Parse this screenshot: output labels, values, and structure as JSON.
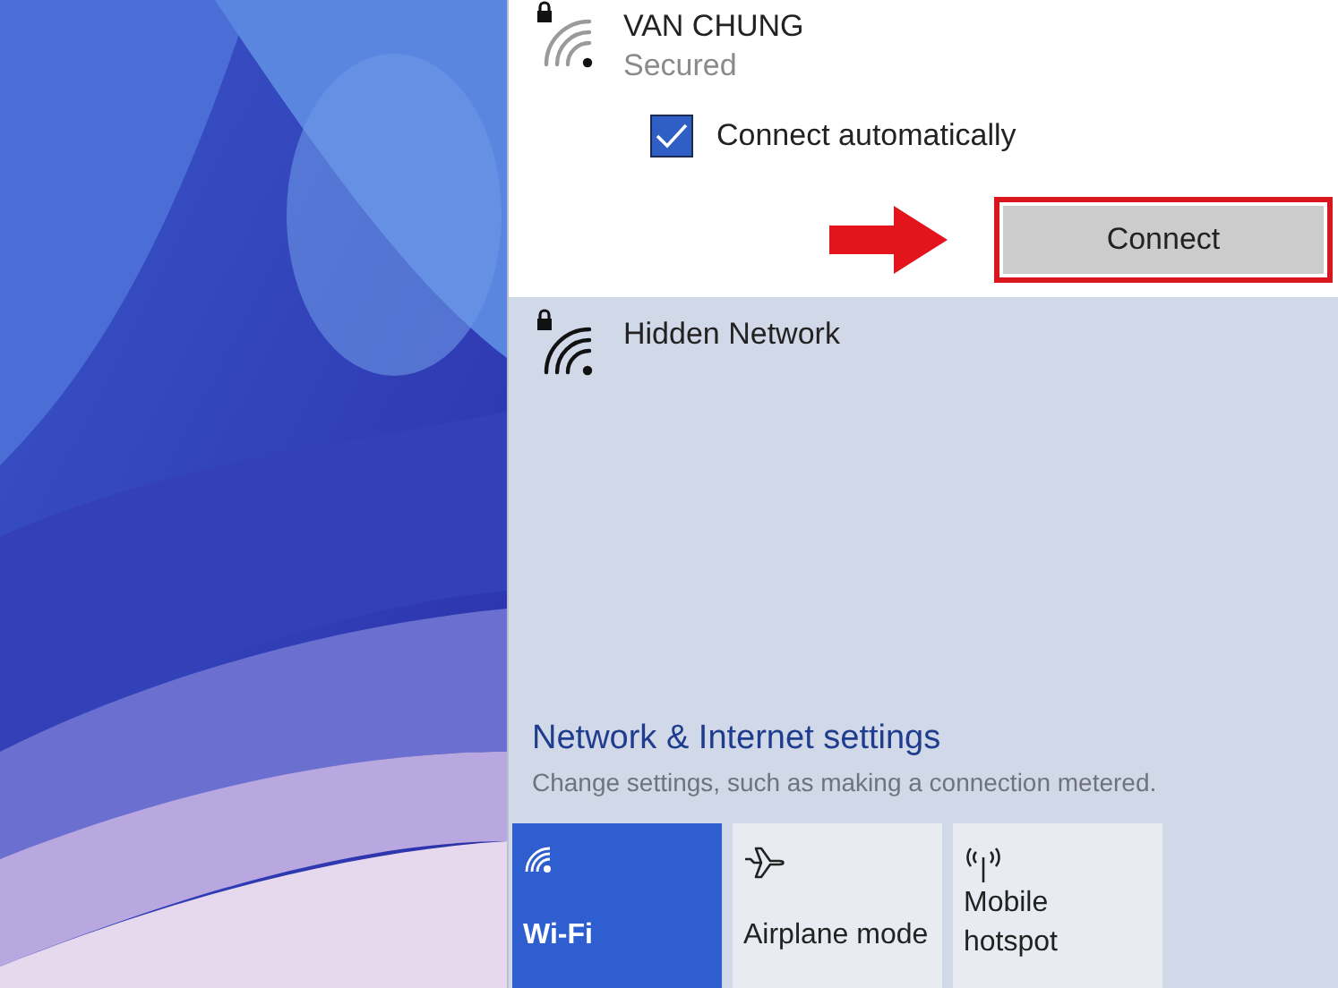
{
  "networks": [
    {
      "name": "VAN CHUNG",
      "status": "Secured",
      "secured": true,
      "expanded": true,
      "auto_connect": {
        "label": "Connect automatically",
        "checked": true
      },
      "button": {
        "label": "Connect",
        "highlighted": true
      }
    },
    {
      "name": "Hidden Network",
      "secured": true,
      "expanded": false
    }
  ],
  "settings_link": {
    "title": "Network & Internet settings",
    "description": "Change settings, such as making a connection metered."
  },
  "quick_actions": [
    {
      "kind": "wifi",
      "label": "Wi-Fi",
      "on": true
    },
    {
      "kind": "airplane",
      "label": "Airplane mode",
      "on": false
    },
    {
      "kind": "hotspot",
      "label": "Mobile\nhotspot",
      "on": false
    }
  ]
}
